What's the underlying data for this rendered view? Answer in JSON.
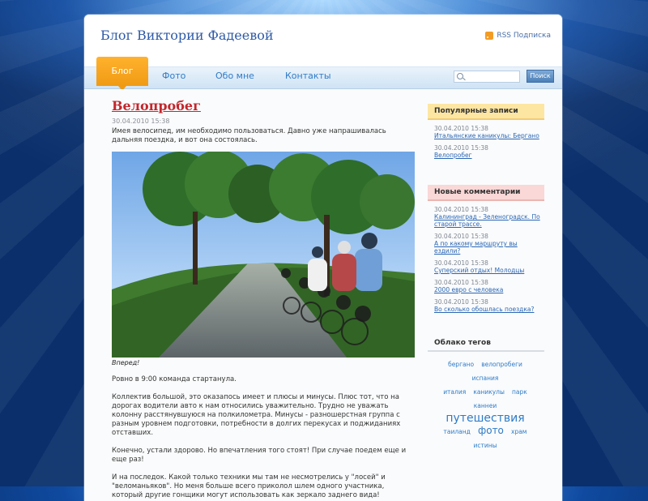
{
  "colors": {
    "accent": "#f09a14",
    "title_blue": "#2e5aa6",
    "post_title_red": "#c2272d",
    "link_blue": "#2b67b5"
  },
  "header": {
    "site_title": "Блог Виктории Фадеевой",
    "rss_label": "RSS Подписка",
    "rss_icon": "rss-icon"
  },
  "nav": {
    "items": [
      "Блог",
      "Фото",
      "Обо мне",
      "Контакты"
    ],
    "active_index": 0
  },
  "search": {
    "placeholder": "",
    "button_label": "Поиск",
    "icon": "search-icon"
  },
  "post": {
    "title": "Велопробег",
    "date": "30.04.2010 15:38",
    "intro": "Имея велосипед, им необходимо пользоваться. Давно уже напрашивалась дальняя поездка, и вот она состоялась.",
    "caption": "Вперед!",
    "paragraphs": [
      "Ровно в 9:00 команда стартанула.",
      "Коллектив большой, это оказапось имеет и плюсы и минусы. Плюс тот, что на дорогах водители авто к нам относились уважительно. Трудно не уважать колонну расстянувшуюся на полкилометра. Минусы - разношерстная группа с разным уровнем подготовки, потребности в долгих перекусах и поджиданиях отставших.",
      "Конечно, устали здорово. Но впечатления того стоят! При случае поедем еще и еще раз!",
      "И на последок. Какой только техники мы там не несмотрелись у \"лосей\" и \"веломаньяков\". Но меня больше всего приколол шлем одного участника, который другие гонщики могут использовать как зеркало заднего вида!"
    ]
  },
  "sidebar": {
    "popular": {
      "title": "Популярные записи",
      "items": [
        {
          "date": "30.04.2010 15:38",
          "link": "Итальянские каникулы: Бергано"
        },
        {
          "date": "30.04.2010 15:38",
          "link": "Велопробег"
        }
      ]
    },
    "comments": {
      "title": "Новые комментарии",
      "items": [
        {
          "date": "30.04.2010 15:38",
          "link": "Калининград - Зеленоградск. По старой трассе."
        },
        {
          "date": "30.04.2010 15:38",
          "link": "А по какому маршруту вы ездили?"
        },
        {
          "date": "30.04.2010 15:38",
          "link": "Суперский отдых! Молодцы"
        },
        {
          "date": "30.04.2010 15:38",
          "link": "2000 евро с человека"
        },
        {
          "date": "30.04.2010 15:38",
          "link": "Во сколько обошлась поездка?"
        }
      ]
    },
    "tags": {
      "title": "Облако тегов",
      "items": [
        {
          "label": "бергано",
          "size": "small"
        },
        {
          "label": "велопробеги",
          "size": "small"
        },
        {
          "label": "испания",
          "size": "small"
        },
        {
          "label": "италия",
          "size": "small"
        },
        {
          "label": "каникулы",
          "size": "small"
        },
        {
          "label": "парк",
          "size": "small"
        },
        {
          "label": "каннеи",
          "size": "small"
        },
        {
          "label": "путешествия",
          "size": "large"
        },
        {
          "label": "таиланд",
          "size": "small"
        },
        {
          "label": "фото",
          "size": "medium"
        },
        {
          "label": "храм",
          "size": "small"
        },
        {
          "label": "истины",
          "size": "small"
        }
      ]
    }
  }
}
